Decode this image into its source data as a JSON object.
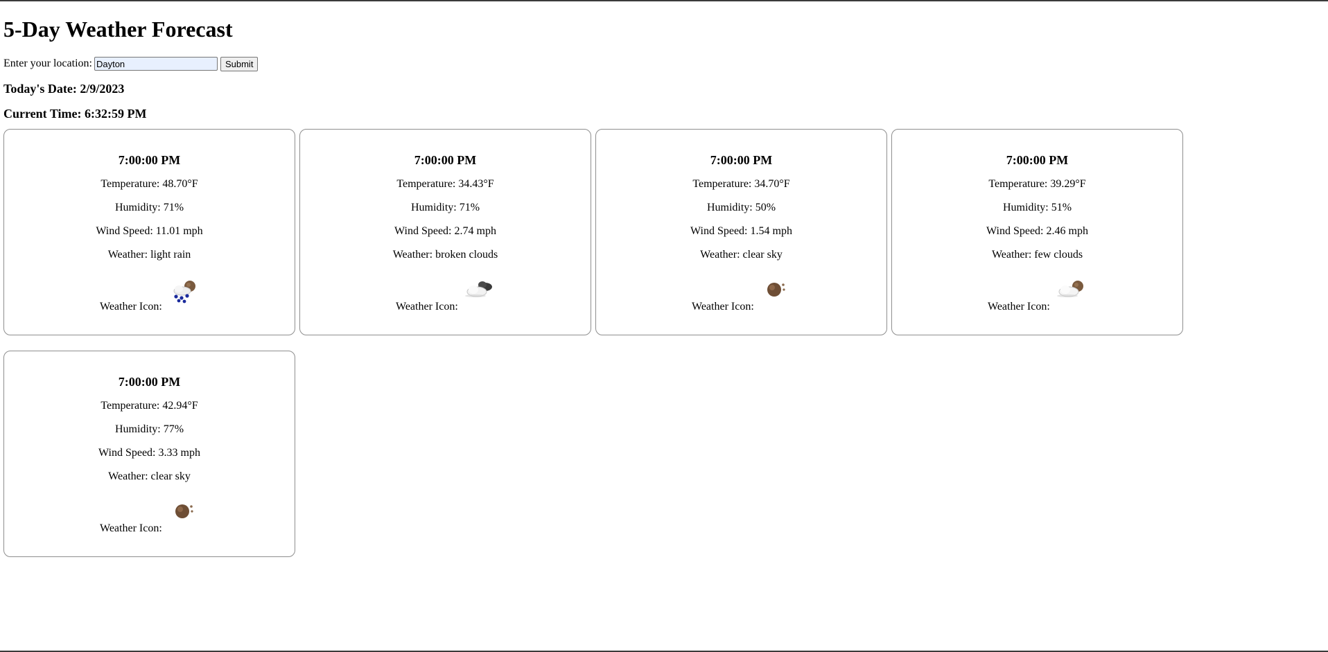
{
  "page": {
    "title": "5-Day Weather Forecast",
    "location_label": "Enter your location:",
    "location_value": "Dayton",
    "submit_label": "Submit",
    "date_text": "Today's Date: 2/9/2023",
    "time_text": "Current Time: 6:32:59 PM"
  },
  "forecast": [
    {
      "time": "7:00:00 PM",
      "temperature": "Temperature: 48.70°F",
      "humidity": "Humidity: 71%",
      "wind": "Wind Speed: 11.01 mph",
      "weather": "Weather: light rain",
      "icon_label": "Weather Icon:",
      "icon": "light-rain-night-icon"
    },
    {
      "time": "7:00:00 PM",
      "temperature": "Temperature: 34.43°F",
      "humidity": "Humidity: 71%",
      "wind": "Wind Speed: 2.74 mph",
      "weather": "Weather: broken clouds",
      "icon_label": "Weather Icon:",
      "icon": "broken-clouds-icon"
    },
    {
      "time": "7:00:00 PM",
      "temperature": "Temperature: 34.70°F",
      "humidity": "Humidity: 50%",
      "wind": "Wind Speed: 1.54 mph",
      "weather": "Weather: clear sky",
      "icon_label": "Weather Icon:",
      "icon": "clear-sky-night-icon"
    },
    {
      "time": "7:00:00 PM",
      "temperature": "Temperature: 39.29°F",
      "humidity": "Humidity: 51%",
      "wind": "Wind Speed: 2.46 mph",
      "weather": "Weather: few clouds",
      "icon_label": "Weather Icon:",
      "icon": "few-clouds-night-icon"
    },
    {
      "time": "7:00:00 PM",
      "temperature": "Temperature: 42.94°F",
      "humidity": "Humidity: 77%",
      "wind": "Wind Speed: 3.33 mph",
      "weather": "Weather: clear sky",
      "icon_label": "Weather Icon:",
      "icon": "clear-sky-night-icon"
    }
  ],
  "colors": {
    "card_border": "#8e8e8e",
    "input_bg": "#e8f0fe",
    "moon": "#7a5a3e",
    "rain": "#1a2a9c"
  }
}
